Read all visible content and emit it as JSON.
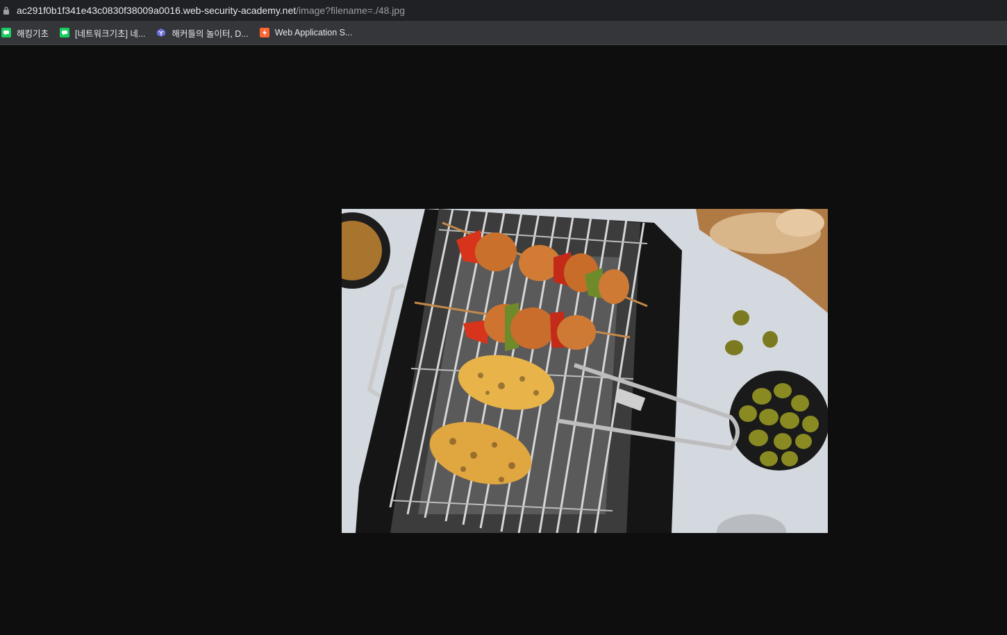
{
  "browser": {
    "url_host": "ac291f0b1f341e43c0830f38009a0016.web-security-academy.net",
    "url_path": "/image?filename=./48.jpg",
    "icons": {
      "lock": "lock-icon"
    }
  },
  "bookmarks": [
    {
      "label": "해킹기초",
      "icon": "green-chat-icon"
    },
    {
      "label": "[네트워크기초] 네...",
      "icon": "green-chat-icon"
    },
    {
      "label": "해커들의 놀이터, D...",
      "icon": "dreamhack-icon"
    },
    {
      "label": "Web Application S...",
      "icon": "portswigger-icon"
    }
  ],
  "content": {
    "image_subject": "grill-with-skewers-and-corn-photo",
    "background_color": "#0e0e0e"
  }
}
